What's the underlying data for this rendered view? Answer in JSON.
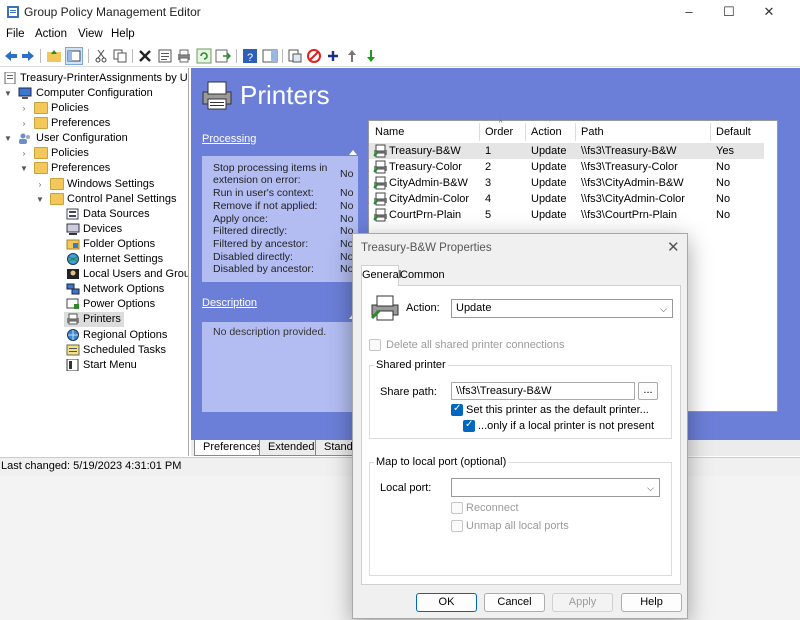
{
  "window": {
    "title": "Group Policy Management Editor",
    "controls": [
      "–",
      "☐",
      "✕"
    ]
  },
  "menu": [
    "File",
    "Action",
    "View",
    "Help"
  ],
  "tree": {
    "root": "Treasury-PrinterAssignments by User",
    "computer_config": "Computer Configuration",
    "cc_policies": "Policies",
    "cc_preferences": "Preferences",
    "user_config": "User Configuration",
    "uc_policies": "Policies",
    "uc_preferences": "Preferences",
    "windows_settings": "Windows Settings",
    "control_panel": "Control Panel Settings",
    "items": [
      "Data Sources",
      "Devices",
      "Folder Options",
      "Internet Settings",
      "Local Users and Groups",
      "Network Options",
      "Power Options",
      "Printers",
      "Regional Options",
      "Scheduled Tasks",
      "Start Menu"
    ]
  },
  "panel": {
    "title": "Printers",
    "processing_link": "Processing",
    "processing": [
      {
        "label": "Stop processing items in",
        "value": ""
      },
      {
        "label": "extension on error:",
        "value": "No"
      },
      {
        "label": "Run in user's context:",
        "value": "No"
      },
      {
        "label": "Remove if not applied:",
        "value": "No"
      },
      {
        "label": "Apply once:",
        "value": "No"
      },
      {
        "label": "Filtered directly:",
        "value": "No"
      },
      {
        "label": "Filtered by ancestor:",
        "value": "No"
      },
      {
        "label": "Disabled directly:",
        "value": "No"
      },
      {
        "label": "Disabled by ancestor:",
        "value": "No"
      }
    ],
    "description_link": "Description",
    "description_text": "No description provided."
  },
  "table": {
    "columns": [
      "Name",
      "Order",
      "Action",
      "Path",
      "Default"
    ],
    "rows": [
      {
        "name": "Treasury-B&W",
        "order": "1",
        "action": "Update",
        "path": "\\\\fs3\\Treasury-B&W",
        "default": "Yes"
      },
      {
        "name": "Treasury-Color",
        "order": "2",
        "action": "Update",
        "path": "\\\\fs3\\Treasury-Color",
        "default": "No"
      },
      {
        "name": "CityAdmin-B&W",
        "order": "3",
        "action": "Update",
        "path": "\\\\fs3\\CityAdmin-B&W",
        "default": "No"
      },
      {
        "name": "CityAdmin-Color",
        "order": "4",
        "action": "Update",
        "path": "\\\\fs3\\CityAdmin-Color",
        "default": "No"
      },
      {
        "name": "CourtPrn-Plain",
        "order": "5",
        "action": "Update",
        "path": "\\\\fs3\\CourtPrn-Plain",
        "default": "No"
      }
    ]
  },
  "bottom_tabs": [
    "Preferences",
    "Extended",
    "Standa"
  ],
  "status": "Last changed: 5/19/2023 4:31:01 PM",
  "dialog": {
    "title": "Treasury-B&W Properties",
    "tabs": [
      "General",
      "Common"
    ],
    "action_label": "Action:",
    "action_value": "Update",
    "delete_all": "Delete all shared printer connections",
    "shared_printer_group": "Shared printer",
    "share_path_label": "Share path:",
    "share_path_value": "\\\\fs3\\Treasury-B&W",
    "browse": "...",
    "set_default": "Set this printer as the default printer...",
    "only_if_local": "...only if a local printer is not present",
    "map_group": "Map to local port (optional)",
    "local_port_label": "Local port:",
    "local_port_value": "",
    "reconnect": "Reconnect",
    "unmap": "Unmap all local ports",
    "buttons": {
      "ok": "OK",
      "cancel": "Cancel",
      "apply": "Apply",
      "help": "Help"
    }
  },
  "colors": {
    "panel_bg": "#6c7fd8",
    "panel_box": "#b3bdf2",
    "accent": "#0067c0"
  }
}
